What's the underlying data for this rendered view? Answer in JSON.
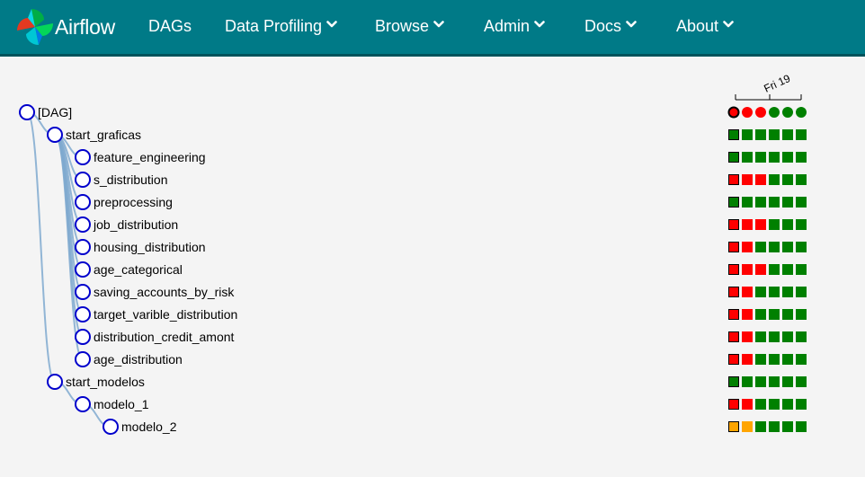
{
  "brand": {
    "name": "Airflow"
  },
  "nav": [
    {
      "label": "DAGs",
      "dropdown": false
    },
    {
      "label": "Data Profiling",
      "dropdown": true
    },
    {
      "label": "Browse",
      "dropdown": true
    },
    {
      "label": "Admin",
      "dropdown": true
    },
    {
      "label": "Docs",
      "dropdown": true
    },
    {
      "label": "About",
      "dropdown": true
    }
  ],
  "colors": {
    "nav_bg": "#007a87",
    "success": "#008000",
    "failed": "#ff0000",
    "upstream_failed": "#ffa500",
    "node_stroke": "#0000cc",
    "link": "#7fa9cf"
  },
  "date_header": "Fri 19",
  "tree": {
    "dag_label": "[DAG]",
    "dag_run_states": [
      "failed",
      "failed",
      "failed",
      "success",
      "success",
      "success"
    ],
    "dag_run_highlight": 0,
    "tasks": [
      {
        "label": "start_graficas",
        "depth": 1,
        "parent": "[DAG]",
        "states": [
          "success",
          "success",
          "success",
          "success",
          "success",
          "success"
        ]
      },
      {
        "label": "feature_engineering",
        "depth": 2,
        "parent": "start_graficas",
        "states": [
          "success",
          "success",
          "success",
          "success",
          "success",
          "success"
        ]
      },
      {
        "label": "s_distribution",
        "depth": 2,
        "parent": "start_graficas",
        "states": [
          "failed",
          "failed",
          "failed",
          "success",
          "success",
          "success"
        ]
      },
      {
        "label": "preprocessing",
        "depth": 2,
        "parent": "start_graficas",
        "states": [
          "success",
          "success",
          "success",
          "success",
          "success",
          "success"
        ]
      },
      {
        "label": "job_distribution",
        "depth": 2,
        "parent": "start_graficas",
        "states": [
          "failed",
          "failed",
          "failed",
          "success",
          "success",
          "success"
        ]
      },
      {
        "label": "housing_distribution",
        "depth": 2,
        "parent": "start_graficas",
        "states": [
          "failed",
          "failed",
          "success",
          "success",
          "success",
          "success"
        ]
      },
      {
        "label": "age_categorical",
        "depth": 2,
        "parent": "start_graficas",
        "states": [
          "failed",
          "failed",
          "failed",
          "success",
          "success",
          "success"
        ]
      },
      {
        "label": "saving_accounts_by_risk",
        "depth": 2,
        "parent": "start_graficas",
        "states": [
          "failed",
          "failed",
          "success",
          "success",
          "success",
          "success"
        ]
      },
      {
        "label": "target_varible_distribution",
        "depth": 2,
        "parent": "start_graficas",
        "states": [
          "failed",
          "failed",
          "success",
          "success",
          "success",
          "success"
        ]
      },
      {
        "label": "distribution_credit_amont",
        "depth": 2,
        "parent": "start_graficas",
        "states": [
          "failed",
          "failed",
          "success",
          "success",
          "success",
          "success"
        ]
      },
      {
        "label": "age_distribution",
        "depth": 2,
        "parent": "start_graficas",
        "states": [
          "failed",
          "failed",
          "success",
          "success",
          "success",
          "success"
        ]
      },
      {
        "label": "start_modelos",
        "depth": 1,
        "parent": "[DAG]",
        "states": [
          "success",
          "success",
          "success",
          "success",
          "success",
          "success"
        ]
      },
      {
        "label": "modelo_1",
        "depth": 2,
        "parent": "start_modelos",
        "states": [
          "failed",
          "failed",
          "success",
          "success",
          "success",
          "success"
        ]
      },
      {
        "label": "modelo_2",
        "depth": 3,
        "parent": "modelo_1",
        "states": [
          "upstream_failed",
          "upstream_failed",
          "success",
          "success",
          "success",
          "success"
        ]
      }
    ]
  }
}
